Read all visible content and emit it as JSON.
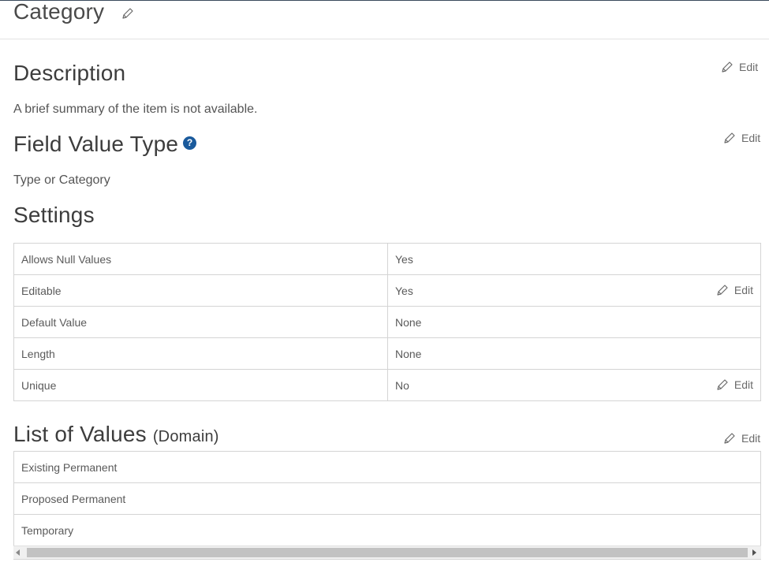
{
  "header": {
    "title": "Category"
  },
  "description": {
    "title": "Description",
    "text": "A brief summary of the item is not available.",
    "edit_label": "Edit"
  },
  "field_value_type": {
    "title": "Field Value Type",
    "help": "?",
    "text": "Type or Category",
    "edit_label": "Edit"
  },
  "settings": {
    "title": "Settings",
    "rows": [
      {
        "name": "Allows Null Values",
        "value": "Yes",
        "edit_label": ""
      },
      {
        "name": "Editable",
        "value": "Yes",
        "edit_label": "Edit"
      },
      {
        "name": "Default Value",
        "value": "None",
        "edit_label": ""
      },
      {
        "name": "Length",
        "value": "None",
        "edit_label": ""
      },
      {
        "name": "Unique",
        "value": "No",
        "edit_label": "Edit"
      }
    ]
  },
  "list_of_values": {
    "title": "List of Values",
    "subtitle": "(Domain)",
    "edit_label": "Edit",
    "items": [
      "Existing Permanent",
      "Proposed Permanent",
      "Temporary"
    ]
  },
  "icons": {
    "edit": "pencil-icon",
    "help": "help-circle-icon"
  }
}
